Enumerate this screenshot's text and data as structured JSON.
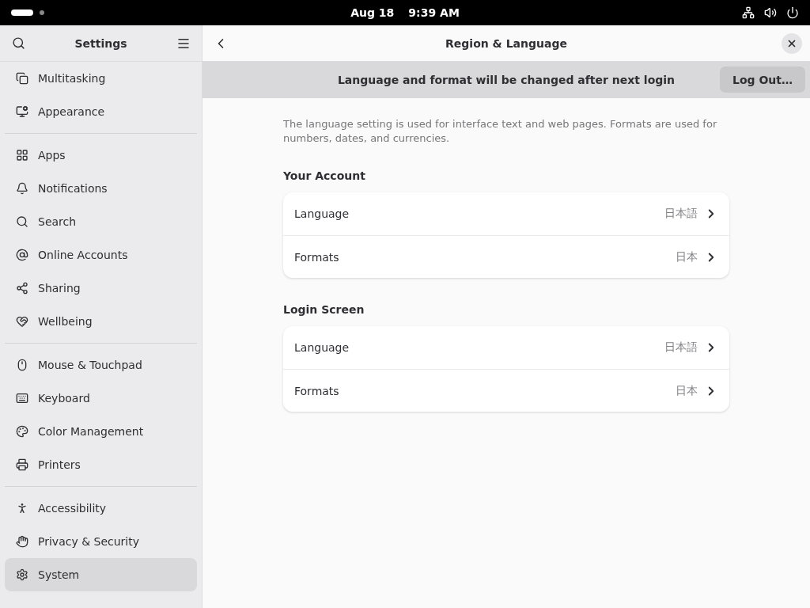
{
  "top_bar": {
    "date": "Aug 18",
    "time": "9:39 AM"
  },
  "sidebar": {
    "title": "Settings",
    "groups": [
      [
        {
          "label": "Multitasking",
          "selected": false
        },
        {
          "label": "Appearance",
          "selected": false
        }
      ],
      [
        {
          "label": "Apps",
          "selected": false
        },
        {
          "label": "Notifications",
          "selected": false
        },
        {
          "label": "Search",
          "selected": false
        },
        {
          "label": "Online Accounts",
          "selected": false
        },
        {
          "label": "Sharing",
          "selected": false
        },
        {
          "label": "Wellbeing",
          "selected": false
        }
      ],
      [
        {
          "label": "Mouse & Touchpad",
          "selected": false
        },
        {
          "label": "Keyboard",
          "selected": false
        },
        {
          "label": "Color Management",
          "selected": false
        },
        {
          "label": "Printers",
          "selected": false
        }
      ],
      [
        {
          "label": "Accessibility",
          "selected": false
        },
        {
          "label": "Privacy & Security",
          "selected": false
        },
        {
          "label": "System",
          "selected": true
        }
      ]
    ]
  },
  "page": {
    "title": "Region & Language",
    "banner": {
      "message": "Language and format will be changed after next login",
      "button": "Log Out…"
    },
    "description": "The language setting is used for interface text and web pages. Formats are used for numbers, dates, and currencies.",
    "sections": [
      {
        "title": "Your Account",
        "rows": [
          {
            "label": "Language",
            "value": "日本語"
          },
          {
            "label": "Formats",
            "value": "日本"
          }
        ]
      },
      {
        "title": "Login Screen",
        "rows": [
          {
            "label": "Language",
            "value": "日本語"
          },
          {
            "label": "Formats",
            "value": "日本"
          }
        ]
      }
    ]
  }
}
